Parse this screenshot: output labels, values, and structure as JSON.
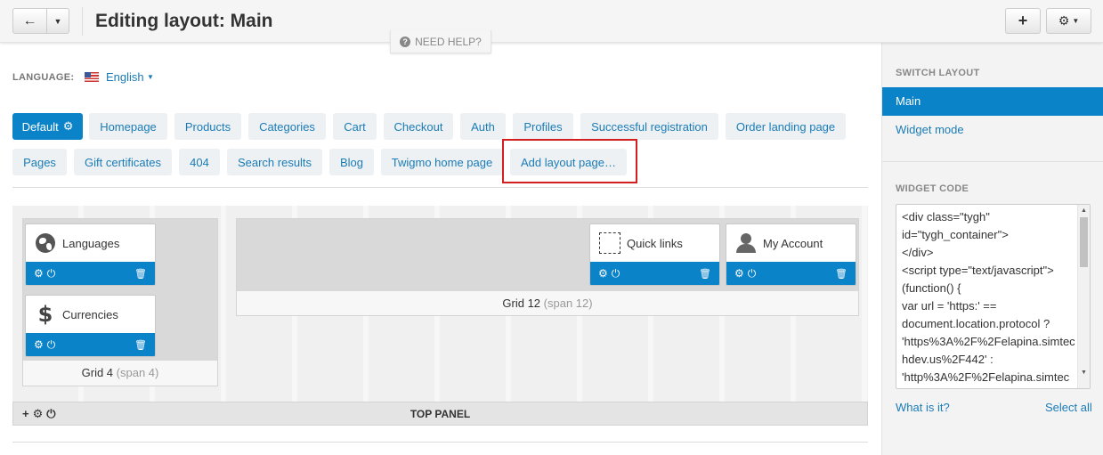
{
  "header": {
    "title": "Editing layout: Main",
    "back_icon": "←",
    "caret_icon": "▼",
    "add_icon": "+",
    "gear_icon": "⚙",
    "gear_caret": "▼"
  },
  "help": {
    "icon": "?",
    "label": "NEED HELP?"
  },
  "language": {
    "label": "LANGUAGE:",
    "value": "English",
    "caret": "▼"
  },
  "tabs": [
    {
      "label": "Default",
      "icon": "⚙"
    },
    {
      "label": "Homepage"
    },
    {
      "label": "Products"
    },
    {
      "label": "Categories"
    },
    {
      "label": "Cart"
    },
    {
      "label": "Checkout"
    },
    {
      "label": "Auth"
    },
    {
      "label": "Profiles"
    },
    {
      "label": "Successful registration"
    },
    {
      "label": "Order landing page"
    },
    {
      "label": "Pages"
    },
    {
      "label": "Gift certificates"
    },
    {
      "label": "404"
    },
    {
      "label": "Search results"
    },
    {
      "label": "Blog"
    },
    {
      "label": "Twigmo home page"
    },
    {
      "label": "Add layout page…"
    }
  ],
  "grids": {
    "grid4": {
      "name": "Grid 4",
      "span": "(span 4)"
    },
    "grid12": {
      "name": "Grid 12",
      "span": "(span 12)"
    }
  },
  "blocks": {
    "languages": "Languages",
    "currencies": "Currencies",
    "currencies_icon": "$",
    "quick_links": "Quick links",
    "my_account": "My Account",
    "gear": "⚙",
    "power": "⏻",
    "trash": "🗑"
  },
  "panel": {
    "title": "TOP PANEL",
    "plus": "+",
    "gear": "⚙",
    "power": "⏻"
  },
  "sidebar": {
    "switch_layout": "SWITCH LAYOUT",
    "layouts": [
      "Main",
      "Widget mode"
    ],
    "widget_code": "WIDGET CODE",
    "code": "<div class=\"tygh\"\nid=\"tygh_container\">\n</div>\n<script type=\"text/javascript\">\n(function() {\nvar url = 'https:' ==\ndocument.location.protocol ?\n'https%3A%2F%2Felapina.simtechdev.us%2F442' :\n'http%3A%2F%2Felapina.simtec",
    "what_is_it": "What is it?",
    "select_all": "Select all"
  }
}
